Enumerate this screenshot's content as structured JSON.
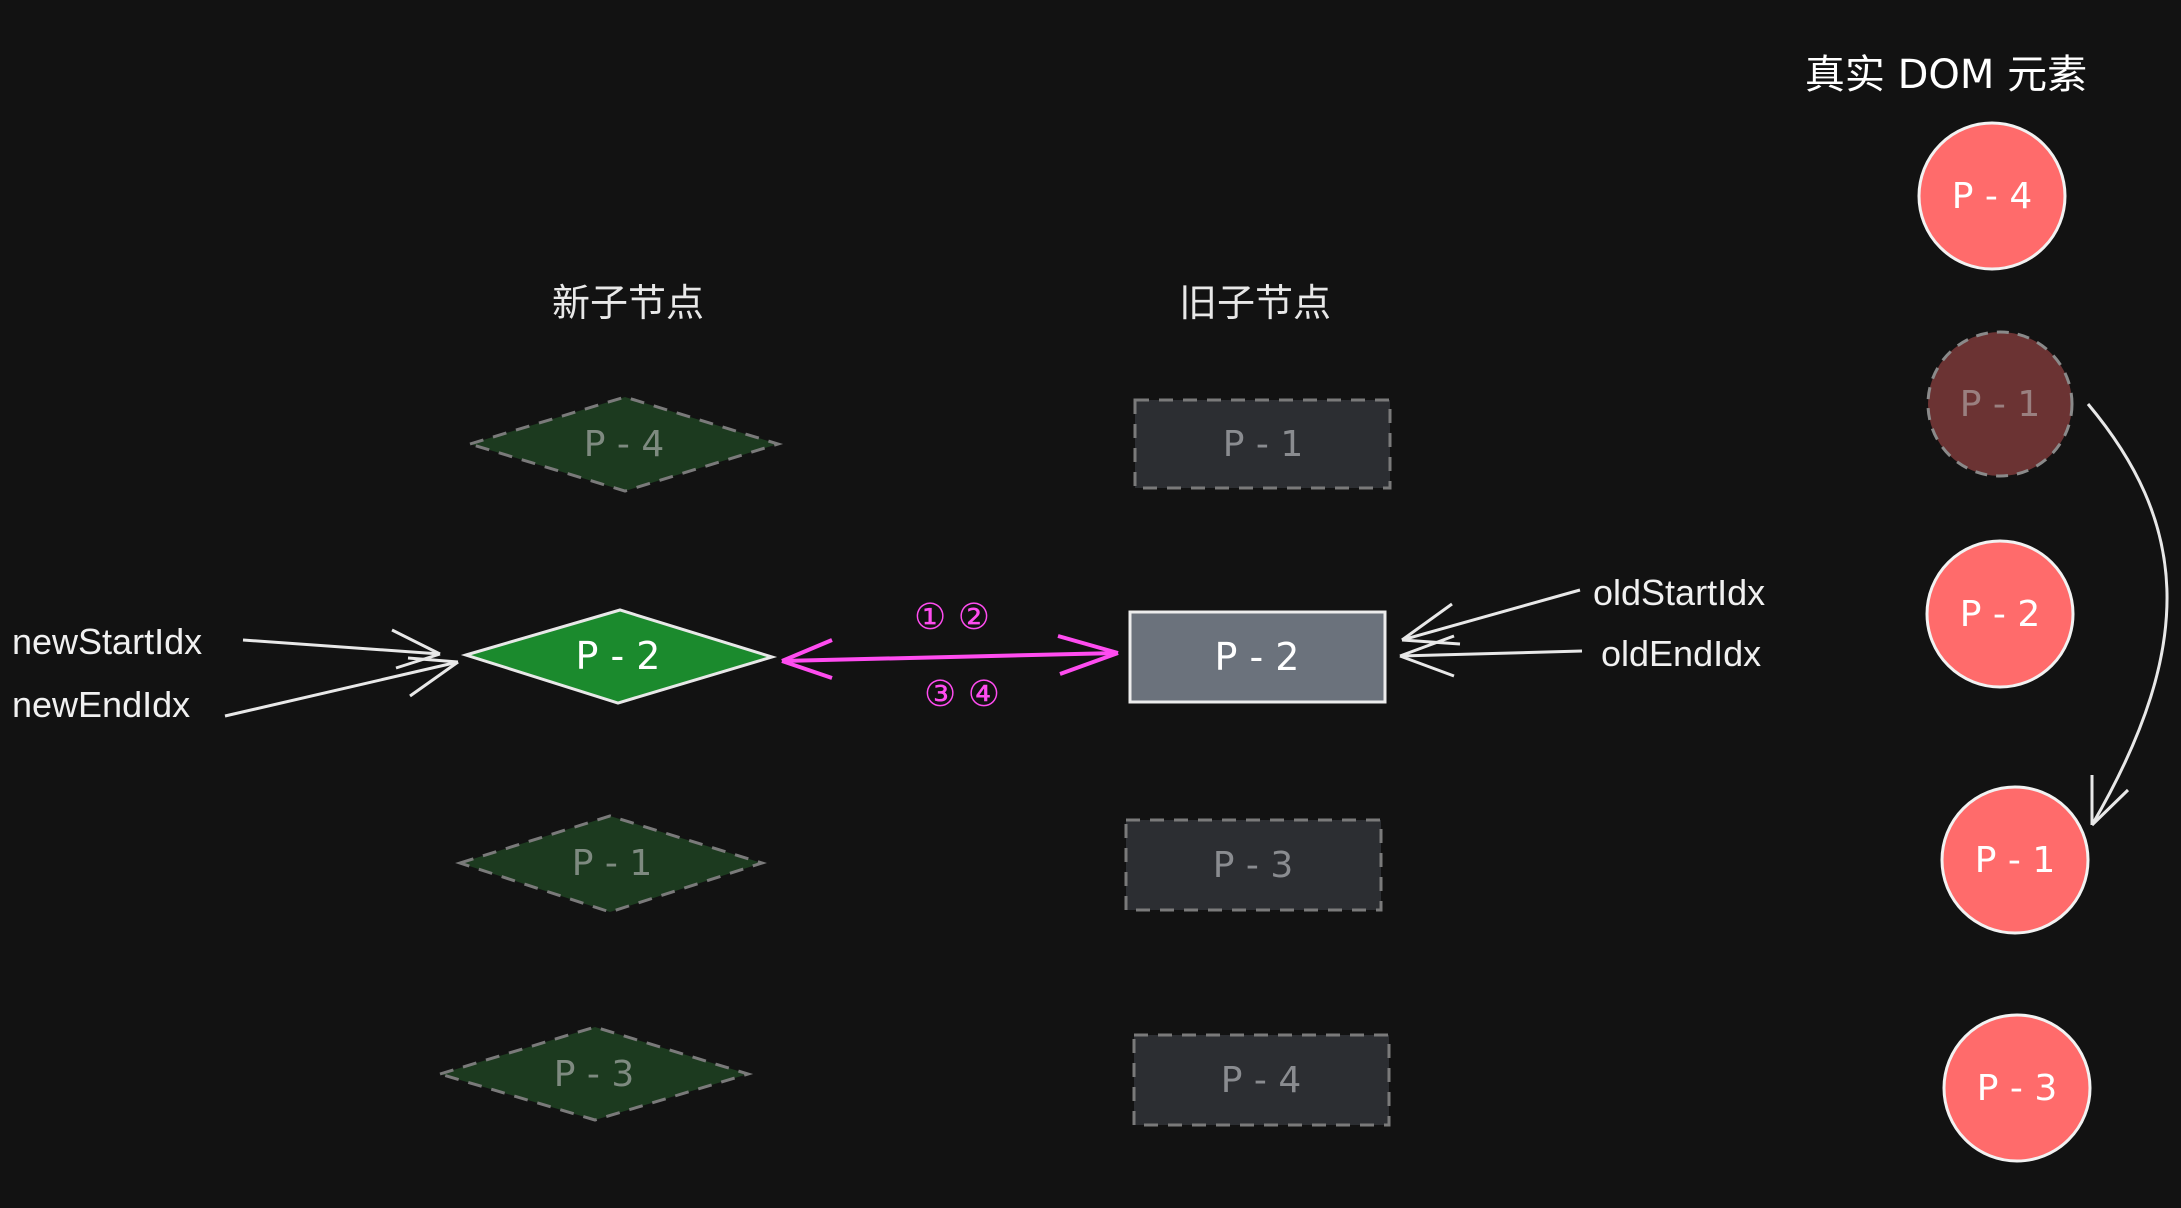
{
  "headers": {
    "new_children": "新子节点",
    "old_children": "旧子节点",
    "real_dom": "真实 DOM 元素"
  },
  "new_nodes": [
    {
      "label": "P - 4",
      "state": "processed"
    },
    {
      "label": "P - 2",
      "state": "active"
    },
    {
      "label": "P - 1",
      "state": "processed"
    },
    {
      "label": "P - 3",
      "state": "processed"
    }
  ],
  "old_nodes": [
    {
      "label": "P - 1",
      "state": "processed"
    },
    {
      "label": "P - 2",
      "state": "active"
    },
    {
      "label": "P - 3",
      "state": "processed"
    },
    {
      "label": "P - 4",
      "state": "processed"
    }
  ],
  "dom_nodes": [
    {
      "label": "P - 4",
      "state": "normal"
    },
    {
      "label": "P - 1",
      "state": "faded"
    },
    {
      "label": "P - 2",
      "state": "normal"
    },
    {
      "label": "P - 1",
      "state": "normal"
    },
    {
      "label": "P - 3",
      "state": "normal"
    }
  ],
  "pointers": {
    "new_start": "newStartIdx",
    "new_end": "newEndIdx",
    "old_start": "oldStartIdx",
    "old_end": "oldEndIdx"
  },
  "compare_steps": {
    "top": "① ②",
    "bottom": "③ ④"
  },
  "colors": {
    "background": "#121212",
    "active_diamond": "#1b8a2d",
    "faded_diamond": "#1c3a1f",
    "active_rect": "#6b727c",
    "faded_rect": "#2c2e32",
    "dom_circle": "#ff6b6b",
    "dom_faded": "#6b3333",
    "compare_arrow": "#ff4cf0"
  }
}
